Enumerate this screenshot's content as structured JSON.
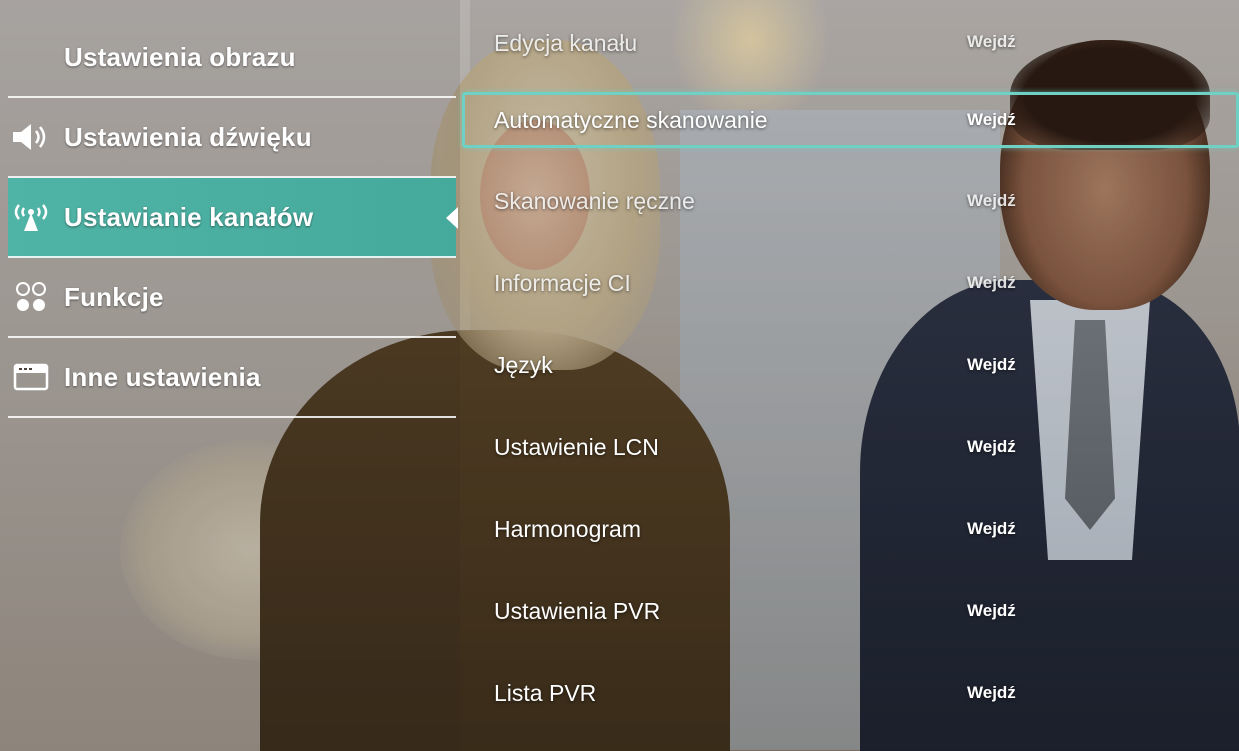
{
  "colors": {
    "accent": "#4fb3a5",
    "focus_outline": "#6fd0c4",
    "text": "#ffffff"
  },
  "sidebar": {
    "items": [
      {
        "label": "Ustawienia obrazu",
        "icon": "picture-icon",
        "active": false
      },
      {
        "label": "Ustawienia dźwięku",
        "icon": "speaker-icon",
        "active": false
      },
      {
        "label": "Ustawianie kanałów",
        "icon": "antenna-icon",
        "active": true
      },
      {
        "label": "Funkcje",
        "icon": "functions-icon",
        "active": false
      },
      {
        "label": "Inne ustawienia",
        "icon": "window-icon",
        "active": false
      }
    ]
  },
  "settings": {
    "rows": [
      {
        "label": "Edycja kanału",
        "action": "Wejdź",
        "focused": false
      },
      {
        "label": "Automatyczne skanowanie",
        "action": "Wejdź",
        "focused": true
      },
      {
        "label": "Skanowanie ręczne",
        "action": "Wejdź",
        "focused": false
      },
      {
        "label": "Informacje CI",
        "action": "Wejdź",
        "focused": false
      },
      {
        "label": "Język",
        "action": "Wejdź",
        "focused": false
      },
      {
        "label": "Ustawienie LCN",
        "action": "Wejdź",
        "focused": false
      },
      {
        "label": "Harmonogram",
        "action": "Wejdź",
        "focused": false
      },
      {
        "label": "Ustawienia PVR",
        "action": "Wejdź",
        "focused": false
      },
      {
        "label": "Lista PVR",
        "action": "Wejdź",
        "focused": false
      }
    ]
  }
}
